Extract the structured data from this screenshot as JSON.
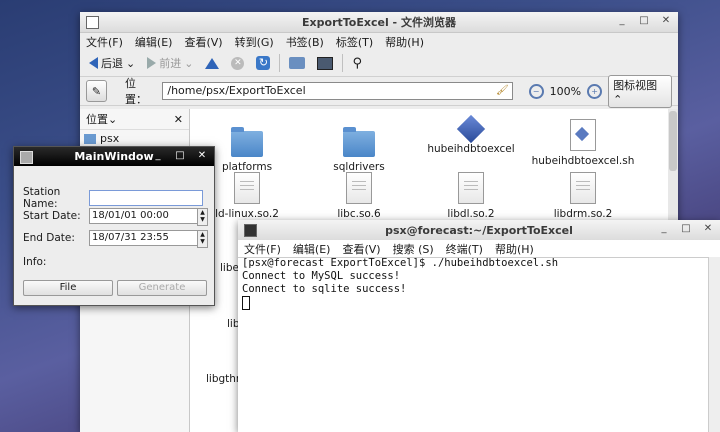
{
  "file_manager": {
    "title": "ExportToExcel - 文件浏览器",
    "menu": [
      "文件(F)",
      "编辑(E)",
      "查看(V)",
      "转到(G)",
      "书签(B)",
      "标签(T)",
      "帮助(H)"
    ],
    "toolbar": {
      "back": "后退",
      "forward": "前进"
    },
    "location_label": "位置：",
    "path": "/home/psx/ExportToExcel",
    "zoom": "100%",
    "view_mode": "图标视图",
    "sidebar": {
      "header": "位置",
      "items": [
        "psx"
      ]
    },
    "files": [
      {
        "name": "platforms",
        "type": "folder"
      },
      {
        "name": "sqldrivers",
        "type": "folder"
      },
      {
        "name": "hubeihdbtoexcel",
        "type": "executable"
      },
      {
        "name": "hubeihdbtoexcel.sh",
        "type": "script"
      },
      {
        "name": "ld-linux.so.2",
        "type": "file"
      },
      {
        "name": "libc.so.6",
        "type": "file"
      },
      {
        "name": "libdl.so.2",
        "type": "file"
      },
      {
        "name": "libdrm.so.2",
        "type": "file"
      }
    ],
    "partial_labels": [
      "libe",
      "lib",
      "libgthre"
    ]
  },
  "terminal": {
    "title": "psx@forecast:~/ExportToExcel",
    "menu": [
      "文件(F)",
      "编辑(E)",
      "查看(V)",
      "搜索 (S)",
      "终端(T)",
      "帮助(H)"
    ],
    "lines": [
      "[psx@forecast ExportToExcel]$ ./hubeihdbtoexcel.sh",
      "Connect to MySQL success!",
      "Connect to sqlite success!"
    ]
  },
  "main_window": {
    "title": "MainWindow",
    "station_label": "Station Name:",
    "station_value": "",
    "start_label": "Start Date:",
    "start_value": "18/01/01 00:00",
    "end_label": "End Date:",
    "end_value": "18/07/31 23:55",
    "info_label": "Info:",
    "file_button": "File",
    "generate_button": "Generate"
  }
}
